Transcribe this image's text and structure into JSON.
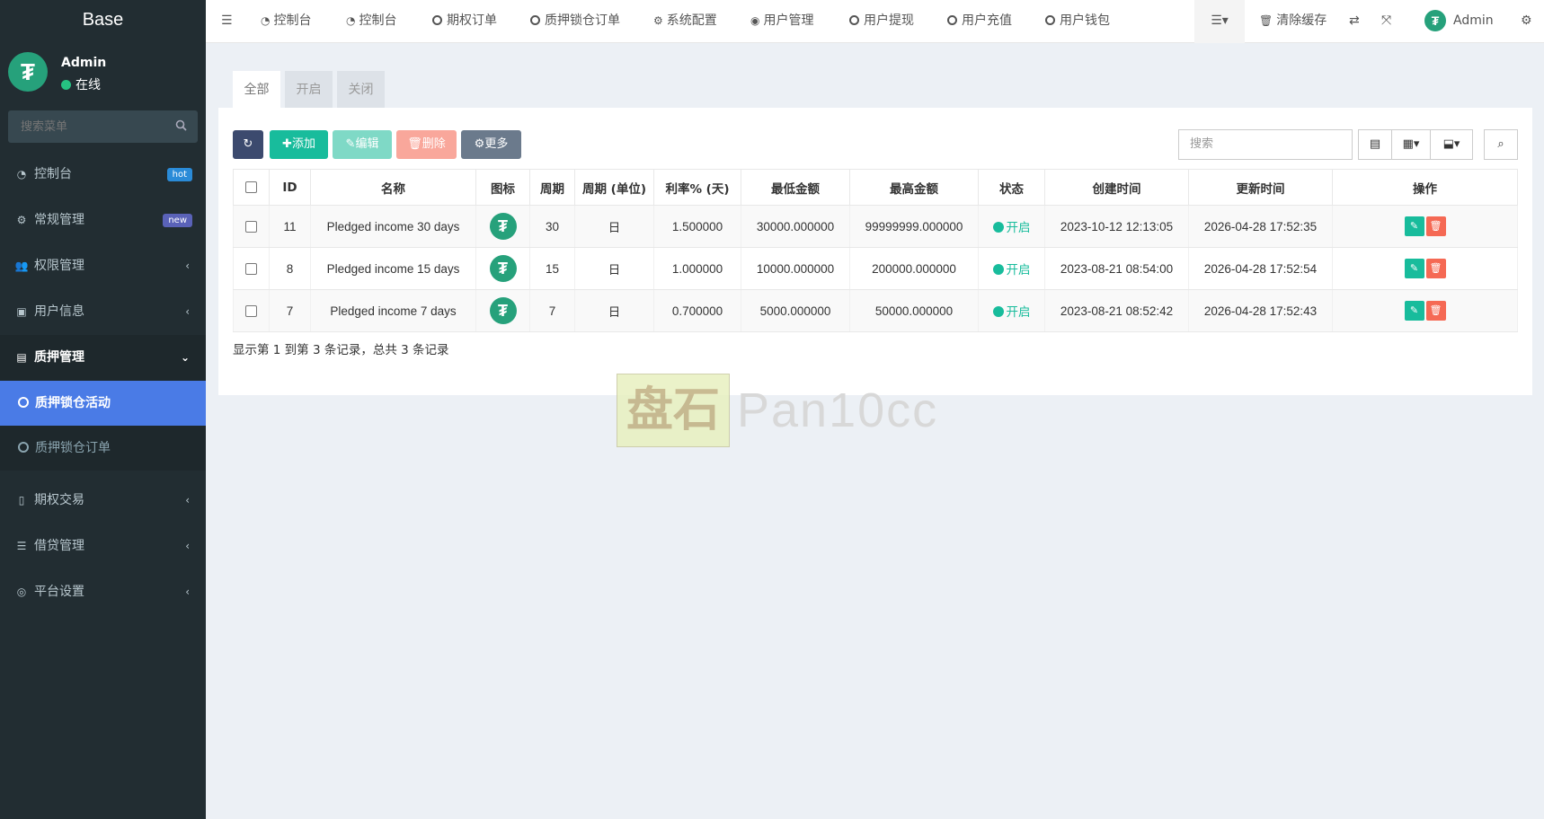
{
  "sidebar": {
    "logo": "Base",
    "user_name": "Admin",
    "user_status": "在线",
    "search_placeholder": "搜索菜单",
    "items": [
      {
        "label": "控制台",
        "badge": "hot",
        "badge_color": "#2a8bd8"
      },
      {
        "label": "常规管理",
        "badge": "new",
        "badge_color": "#5a62b8"
      },
      {
        "label": "权限管理"
      },
      {
        "label": "用户信息"
      },
      {
        "label": "质押管理"
      },
      {
        "label": "期权交易"
      },
      {
        "label": "借贷管理"
      },
      {
        "label": "平台设置"
      }
    ],
    "submenu": [
      {
        "label": "质押锁仓活动"
      },
      {
        "label": "质押锁仓订单"
      }
    ]
  },
  "topbar": {
    "nav": [
      "控制台",
      "控制台",
      "期权订单",
      "质押锁仓订单",
      "系统配置",
      "用户管理",
      "用户提现",
      "用户充值",
      "用户钱包"
    ],
    "clear_cache": "清除缓存",
    "admin": "Admin"
  },
  "tabs": [
    "全部",
    "开启",
    "关闭"
  ],
  "toolbar": {
    "add": "添加",
    "edit": "编辑",
    "delete": "删除",
    "more": "更多",
    "search_placeholder": "搜索"
  },
  "table": {
    "headers": [
      "ID",
      "名称",
      "图标",
      "周期",
      "周期 (单位)",
      "利率% (天)",
      "最低金额",
      "最高金额",
      "状态",
      "创建时间",
      "更新时间",
      "操作"
    ],
    "rows": [
      {
        "id": "11",
        "name": "Pledged income 30 days",
        "cycle": "30",
        "unit": "日",
        "rate": "1.500000",
        "min": "30000.000000",
        "max": "99999999.000000",
        "status": "开启",
        "created": "2023-10-12 12:13:05",
        "updated": "2026-04-28 17:52:35"
      },
      {
        "id": "8",
        "name": "Pledged income 15 days",
        "cycle": "15",
        "unit": "日",
        "rate": "1.000000",
        "min": "10000.000000",
        "max": "200000.000000",
        "status": "开启",
        "created": "2023-08-21 08:54:00",
        "updated": "2026-04-28 17:52:54"
      },
      {
        "id": "7",
        "name": "Pledged income 7 days",
        "cycle": "7",
        "unit": "日",
        "rate": "0.700000",
        "min": "5000.000000",
        "max": "50000.000000",
        "status": "开启",
        "created": "2023-08-21 08:52:42",
        "updated": "2026-04-28 17:52:43"
      }
    ]
  },
  "summary": "显示第 1 到第 3 条记录，总共 3 条记录",
  "watermark": {
    "logo": "盘石",
    "text": "Pan10cc"
  },
  "colors": {
    "sidebar": "#222d32",
    "active": "#4a7be6",
    "add": "#18bc9c",
    "delete": "#f56954",
    "primary": "#3c4a6e",
    "coin": "#26a17b"
  }
}
